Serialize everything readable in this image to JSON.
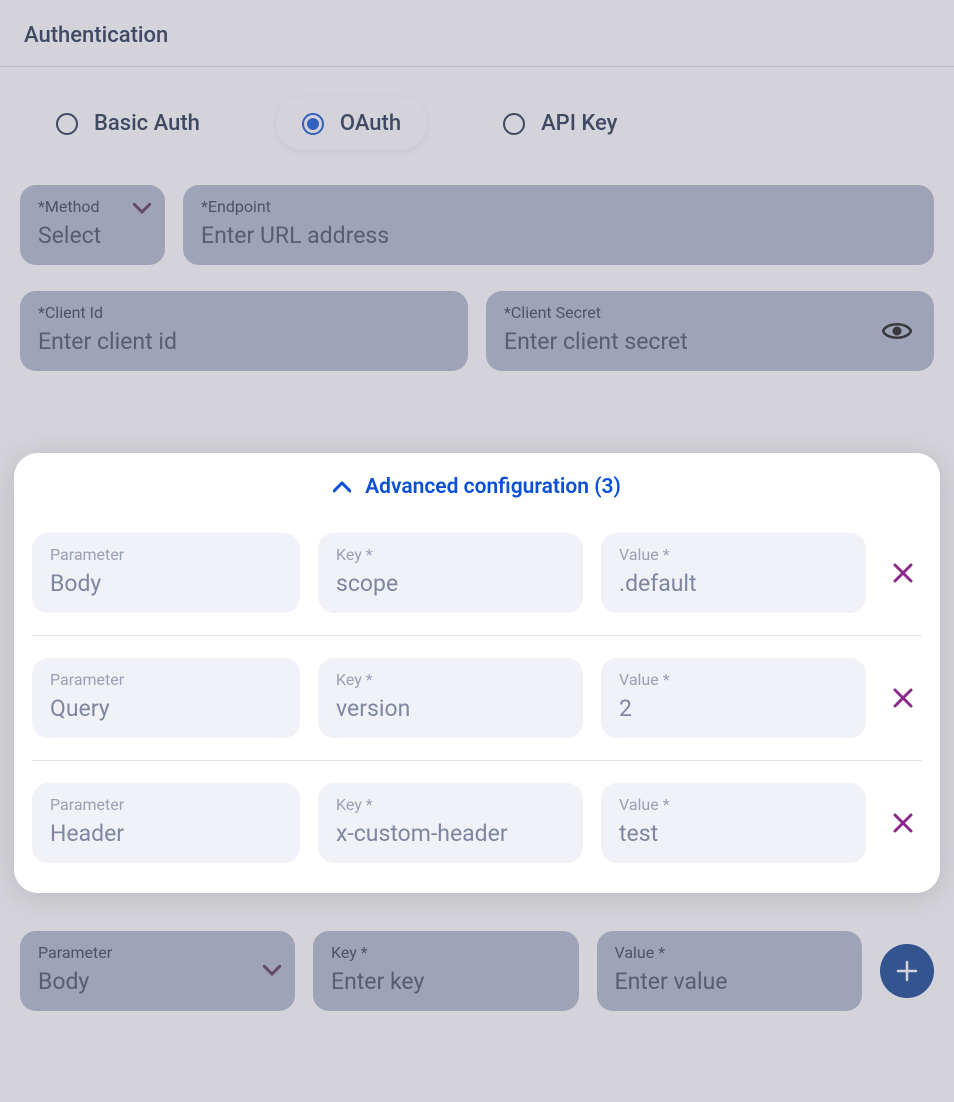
{
  "title": "Authentication",
  "tabs": {
    "basic": "Basic Auth",
    "oauth": "OAuth",
    "apikey": "API Key"
  },
  "method": {
    "label": "*Method",
    "value": "Select"
  },
  "endpoint": {
    "label": "*Endpoint",
    "placeholder": "Enter URL address"
  },
  "client_id": {
    "label": "*Client Id",
    "placeholder": "Enter client id"
  },
  "client_secret": {
    "label": "*Client Secret",
    "placeholder": "Enter client secret"
  },
  "advanced": {
    "header": "Advanced configuration (3)",
    "param_label": "Parameter",
    "key_label": "Key *",
    "value_label": "Value *",
    "rows": [
      {
        "param": "Body",
        "key": "scope",
        "value": ".default"
      },
      {
        "param": "Query",
        "key": "version",
        "value": "2"
      },
      {
        "param": "Header",
        "key": "x-custom-header",
        "value": "test"
      }
    ]
  },
  "add_row": {
    "param_label": "Parameter",
    "param_value": "Body",
    "key_label": "Key *",
    "key_placeholder": "Enter key",
    "value_label": "Value *",
    "value_placeholder": "Enter value"
  },
  "colors": {
    "accent": "#0b4fd6",
    "danger": "#8c2a8c"
  }
}
